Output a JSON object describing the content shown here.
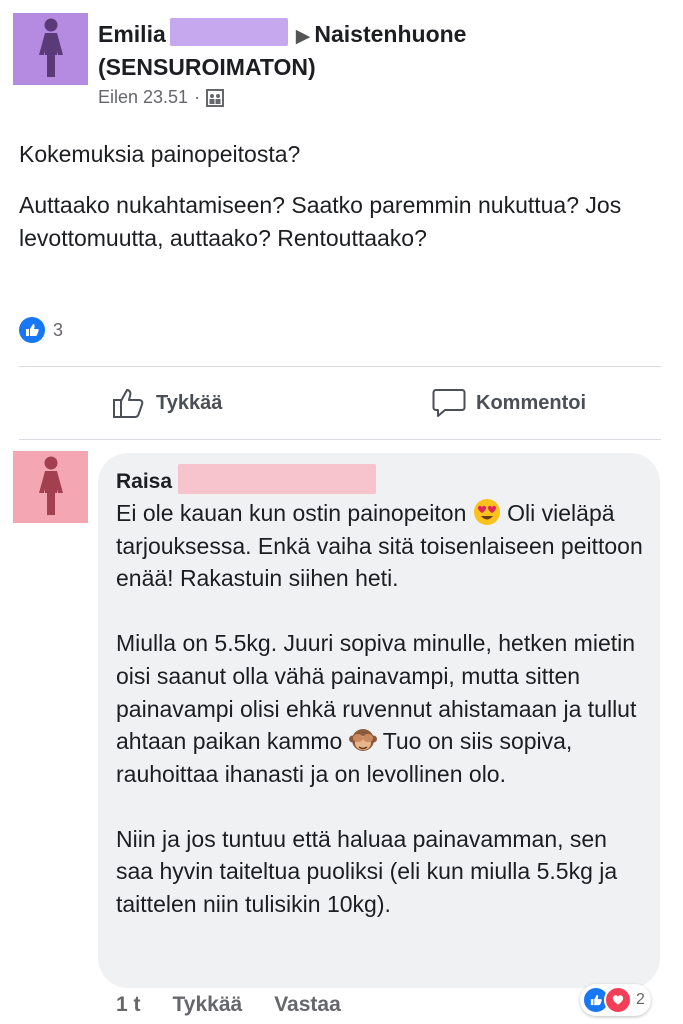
{
  "post": {
    "author_first": "Emilia",
    "group": "Naistenhuone (SENSUROIMATON)",
    "time": "Eilen 23.51",
    "separator": "·",
    "title_line": "Kokemuksia painopeitosta?",
    "body_line": "Auttaako nukahtamiseen? Saatko paremmin nukuttua? Jos levottomuutta, auttaako? Rentouttaako?",
    "reaction_count": "3",
    "avatar_color": "#b48be0"
  },
  "actions": {
    "like_label": "Tykkää",
    "comment_label": "Kommentoi"
  },
  "comment": {
    "author_first": "Raisa",
    "avatar_color": "#f4a7b3",
    "p1_a": "Ei ole kauan kun ostin painopeiton",
    "p1_b": "Oli vieläpä tarjouksessa. Enkä vaiha sitä toisenlaiseen peittoon enää! Rakastuin siihen heti.",
    "p2_a": "Miulla on 5.5kg. Juuri sopiva minulle, hetken mietin oisi saanut olla vähä painavampi, mutta sitten painavampi olisi ehkä ruvennut ahistamaan ja tullut ahtaan paikan kammo",
    "p2_b": "Tuo on siis sopiva, rauhoittaa ihanasti ja on levollinen olo.",
    "p3": "Niin ja jos tuntuu että haluaa painavamman, sen saa hyvin taiteltua puoliksi (eli kun miulla 5.5kg ja taittelen niin tulisikin 10kg).",
    "time": "1 t",
    "like_label": "Tykkää",
    "reply_label": "Vastaa",
    "reaction_count": "2"
  },
  "colors": {
    "like_blue": "#1877f2",
    "love_red": "#f33e58",
    "redaction_purple": "#c6a8ef",
    "redaction_pink": "#f7c3cd"
  },
  "icons": {
    "avatar": "person-icon",
    "privacy": "group-privacy-icon",
    "like": "thumbs-up-icon",
    "comment": "speech-bubble-icon",
    "emoji1": "heart-eyes-emoji",
    "emoji2": "see-no-evil-monkey-emoji"
  }
}
